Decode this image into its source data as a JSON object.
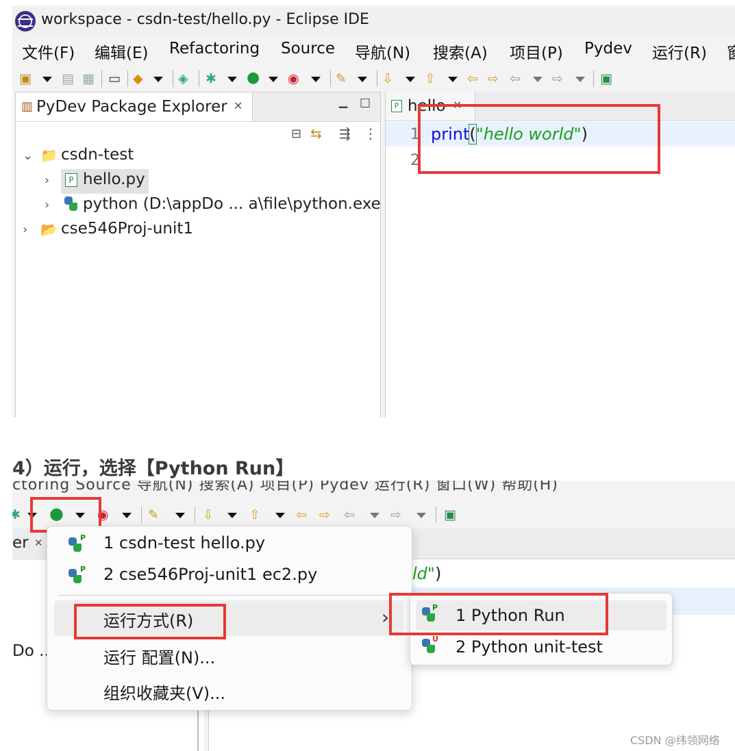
{
  "window": {
    "title": "workspace - csdn-test/hello.py - Eclipse IDE"
  },
  "menubar": {
    "items": [
      "文件(F)",
      "编辑(E)",
      "Refactoring",
      "Source",
      "导航(N)",
      "搜索(A)",
      "项目(P)",
      "Pydev",
      "运行(R)",
      "窗"
    ]
  },
  "explorer": {
    "title": "PyDev Package Explorer",
    "close": "✕",
    "tree": {
      "project1": "csdn-test",
      "file1": "hello.py",
      "interpreter": "python  (D:\\appDo ... a\\file\\python.exe",
      "project2": "cse546Proj-unit1"
    }
  },
  "editor": {
    "tab_label": "hello",
    "tab_close": "✕",
    "line_numbers": [
      "1",
      "2"
    ],
    "code": {
      "func": "print",
      "open": "(",
      "string": "\"hello world\"",
      "close": ")"
    }
  },
  "step": {
    "heading": "4）运行，选择【Python Run】"
  },
  "shot2": {
    "cut_text": "ctoring   Source   导航(N)   搜索(A)   项目(P)   Pydev   运行(R)   窗口(W)   帮助(H)",
    "left_tab_fragment": "er",
    "left_tab_close": "✕",
    "left_fragment": "Do ..",
    "editor_fragment_str": "ld\"",
    "editor_fragment_close": ")"
  },
  "run_menu": {
    "recent": [
      {
        "label": "1 csdn-test hello.py"
      },
      {
        "label": "2 cse546Proj-unit1 ec2.py"
      }
    ],
    "run_as": "运行方式(R)",
    "run_config": "运行 配置(N)...",
    "favorites": "组织收藏夹(V)...",
    "submenu_arrow": "›"
  },
  "run_as_submenu": [
    {
      "label": "1 Python Run",
      "badge": "P"
    },
    {
      "label": "2 Python unit-test",
      "badge": "U"
    }
  ],
  "watermark": "CSDN @纬领网络",
  "colors": {
    "highlight_red": "#e53935",
    "keyword_blue": "#1010d8",
    "string_green": "#1e9b1e"
  }
}
